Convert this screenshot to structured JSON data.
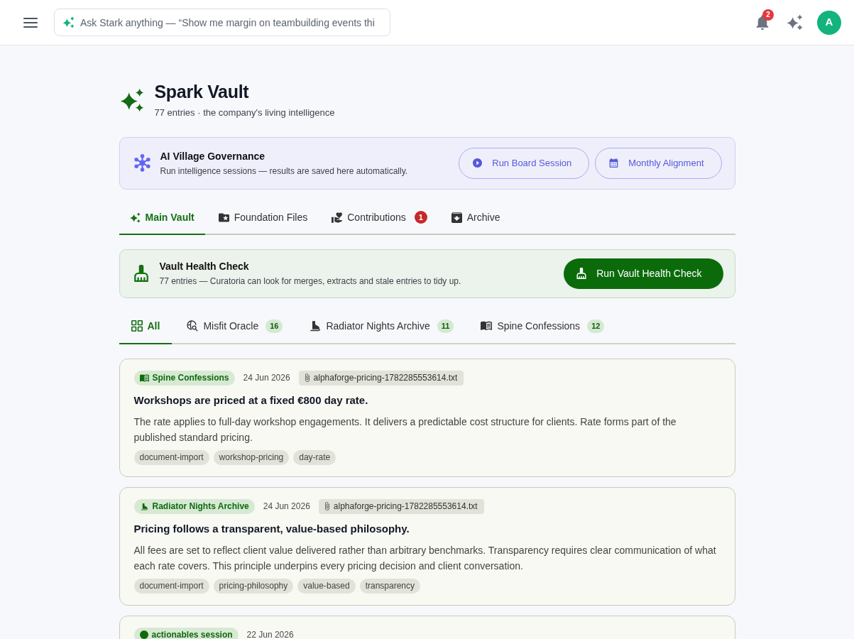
{
  "top_bar": {
    "search": {
      "placeholder": "Ask Stark anything — “Show me margin on teambuilding events thi"
    },
    "notification_count": "2",
    "avatar_initial": "A"
  },
  "header": {
    "title": "Spark Vault",
    "subtitle": "77 entries · the company's living intelligence"
  },
  "governance": {
    "title": "AI Village Governance",
    "description": "Run intelligence sessions — results are saved here automatically.",
    "buttons": [
      "Run Board Session",
      "Monthly Alignment"
    ]
  },
  "tabs": [
    {
      "label": "Main Vault",
      "selected": true
    },
    {
      "label": "Foundation Files",
      "selected": false
    },
    {
      "label": "Contributions",
      "selected": false,
      "badge": "1"
    },
    {
      "label": "Archive",
      "selected": false
    }
  ],
  "health_check": {
    "title": "Vault Health Check",
    "description": "77 entries — Curatoria can look for merges, extracts and stale entries to tidy up.",
    "button": "Run Vault Health Check"
  },
  "filters": [
    {
      "kind": "all",
      "label": "All",
      "selected": true
    },
    {
      "kind": "oracle",
      "label": "Misfit Oracle",
      "count": "16",
      "selected": false
    },
    {
      "kind": "radiator",
      "label": "Radiator Nights Archive",
      "count": "11",
      "selected": false
    },
    {
      "kind": "spine",
      "label": "Spine Confessions",
      "count": "12",
      "selected": false
    }
  ],
  "entries": [
    {
      "kind": "spine",
      "category": "Spine Confessions",
      "date": "24 Jun 2026",
      "attachment": "alphaforge-pricing-1782285553614.txt",
      "title": "Workshops are priced at a fixed €800 day rate.",
      "body": "The rate applies to full-day workshop engagements. It delivers a predictable cost structure for clients. Rate forms part of the published standard pricing.",
      "tags": [
        "document-import",
        "workshop-pricing",
        "day-rate"
      ]
    },
    {
      "kind": "radiator",
      "category": "Radiator Nights Archive",
      "date": "24 Jun 2026",
      "attachment": "alphaforge-pricing-1782285553614.txt",
      "title": "Pricing follows a transparent, value-based philosophy.",
      "body": "All fees are set to reflect client value delivered rather than arbitrary benchmarks. Transparency requires clear communication of what each rate covers. This principle underpins every pricing decision and client conversation.",
      "tags": [
        "document-import",
        "pricing-philosophy",
        "value-based",
        "transparency"
      ]
    },
    {
      "kind": "session",
      "category": "actionables session",
      "date": "22 Jun 2026"
    }
  ]
}
